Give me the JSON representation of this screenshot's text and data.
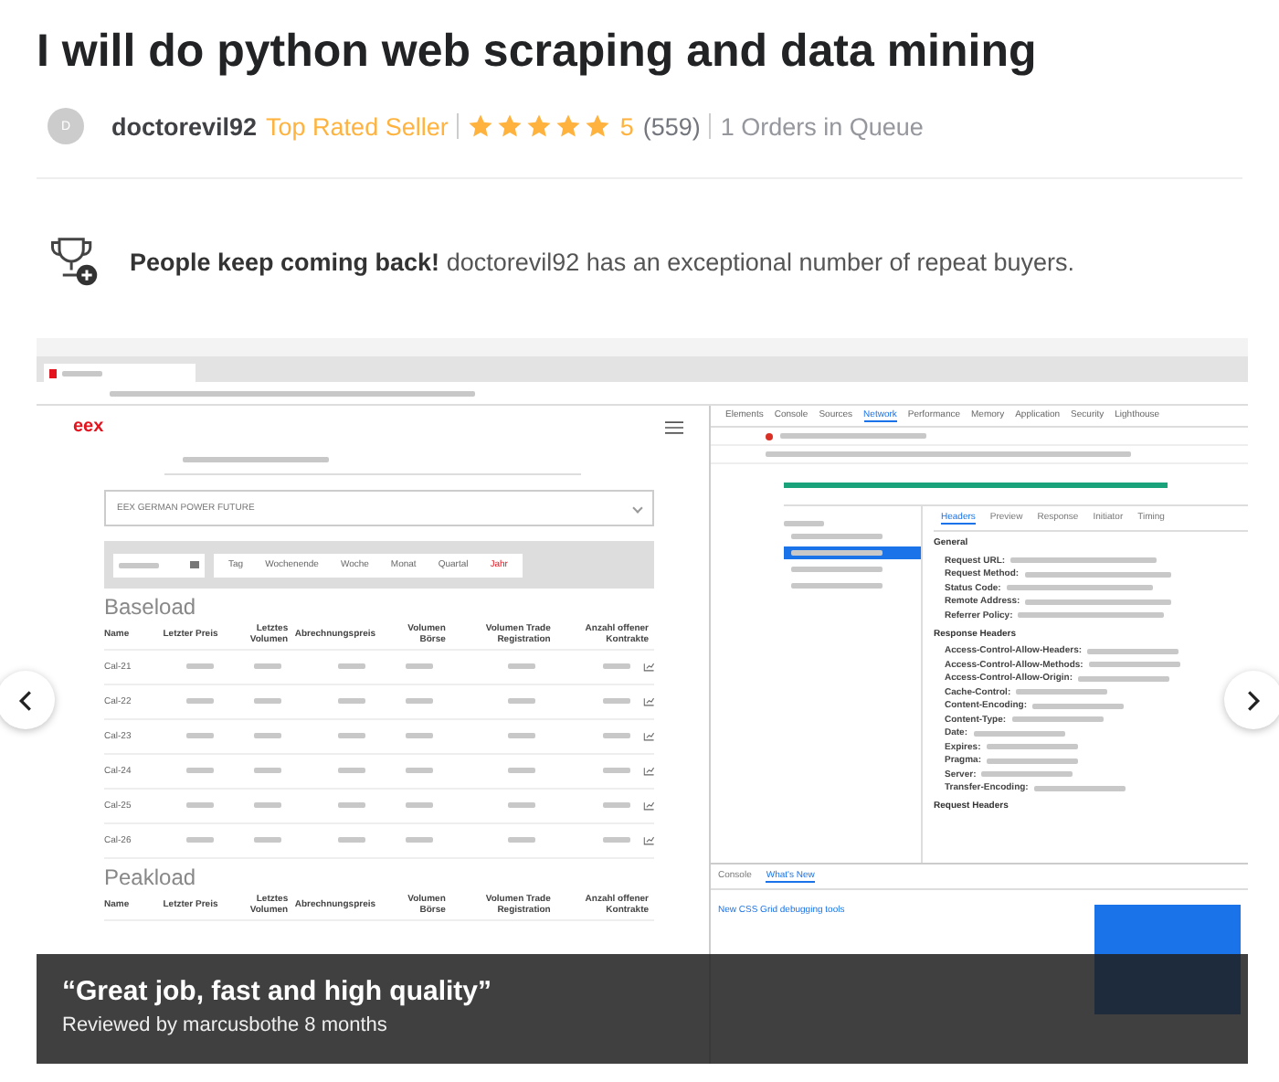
{
  "title": "I will do python web scraping and data mining",
  "seller": {
    "avatar_letter": "D",
    "name": "doctorevil92",
    "badge": "Top Rated Seller",
    "stars": 5,
    "rating": "5",
    "reviews": "(559)",
    "queue": "1 Orders in Queue"
  },
  "highlight": {
    "text": "**People keep coming back!** doctorevil92 has an exceptional number of repeat buyers."
  },
  "gallery": {
    "screenshot": {
      "logo": "eex",
      "dropdown": "EEX GERMAN POWER FUTURE",
      "periods": [
        {
          "label": "Tag",
          "selected": false
        },
        {
          "label": "Wochenende",
          "selected": false
        },
        {
          "label": "Woche",
          "selected": false
        },
        {
          "label": "Monat",
          "selected": false
        },
        {
          "label": "Quartal",
          "selected": false
        },
        {
          "label": "Jahr",
          "selected": true
        }
      ],
      "sections": [
        {
          "title": "Baseload",
          "columns": [
            "Name",
            "Letzter Preis",
            "Letztes Volumen",
            "Abrechnungspreis",
            "Volumen Börse",
            "Volumen Trade Registration",
            "Anzahl offener Kontrakte"
          ],
          "rows": [
            "Cal-21",
            "Cal-22",
            "Cal-23",
            "Cal-24",
            "Cal-25",
            "Cal-26"
          ]
        },
        {
          "title": "Peakload",
          "columns": [
            "Name",
            "Letzter Preis",
            "Letztes Volumen",
            "Abrechnungspreis",
            "Volumen Börse",
            "Volumen Trade Registration",
            "Anzahl offener Kontrakte"
          ]
        }
      ],
      "devtools": {
        "tabs": [
          {
            "label": "Elements",
            "selected": false
          },
          {
            "label": "Console",
            "selected": false
          },
          {
            "label": "Sources",
            "selected": false
          },
          {
            "label": "Network",
            "selected": true
          },
          {
            "label": "Performance",
            "selected": false
          },
          {
            "label": "Memory",
            "selected": false
          },
          {
            "label": "Application",
            "selected": false
          },
          {
            "label": "Security",
            "selected": false
          },
          {
            "label": "Lighthouse",
            "selected": false
          }
        ],
        "requests": [
          {
            "selected": false
          },
          {
            "selected": true
          },
          {
            "selected": false
          },
          {
            "selected": false
          }
        ],
        "detail_tabs": [
          {
            "label": "Headers",
            "selected": true
          },
          {
            "label": "Preview",
            "selected": false
          },
          {
            "label": "Response",
            "selected": false
          },
          {
            "label": "Initiator",
            "selected": false
          },
          {
            "label": "Timing",
            "selected": false
          }
        ],
        "general": "General",
        "general_fields": [
          "Request URL:",
          "Request Method:",
          "Status Code:",
          "Remote Address:",
          "Referrer Policy:"
        ],
        "response_title": "Response Headers",
        "response_fields": [
          "Access-Control-Allow-Headers:",
          "Access-Control-Allow-Methods:",
          "Access-Control-Allow-Origin:",
          "Cache-Control:",
          "Content-Encoding:",
          "Content-Type:",
          "Date:",
          "Expires:",
          "Pragma:",
          "Server:",
          "Transfer-Encoding:"
        ],
        "request_title": "Request Headers",
        "drawer_tabs": [
          {
            "label": "Console",
            "selected": false
          },
          {
            "label": "What's New",
            "selected": true
          }
        ],
        "article": "New CSS Grid debugging tools"
      }
    },
    "review": {
      "quote": "“Great job, fast and high quality”",
      "byline": "Reviewed by marcusbothe 8 months"
    }
  }
}
